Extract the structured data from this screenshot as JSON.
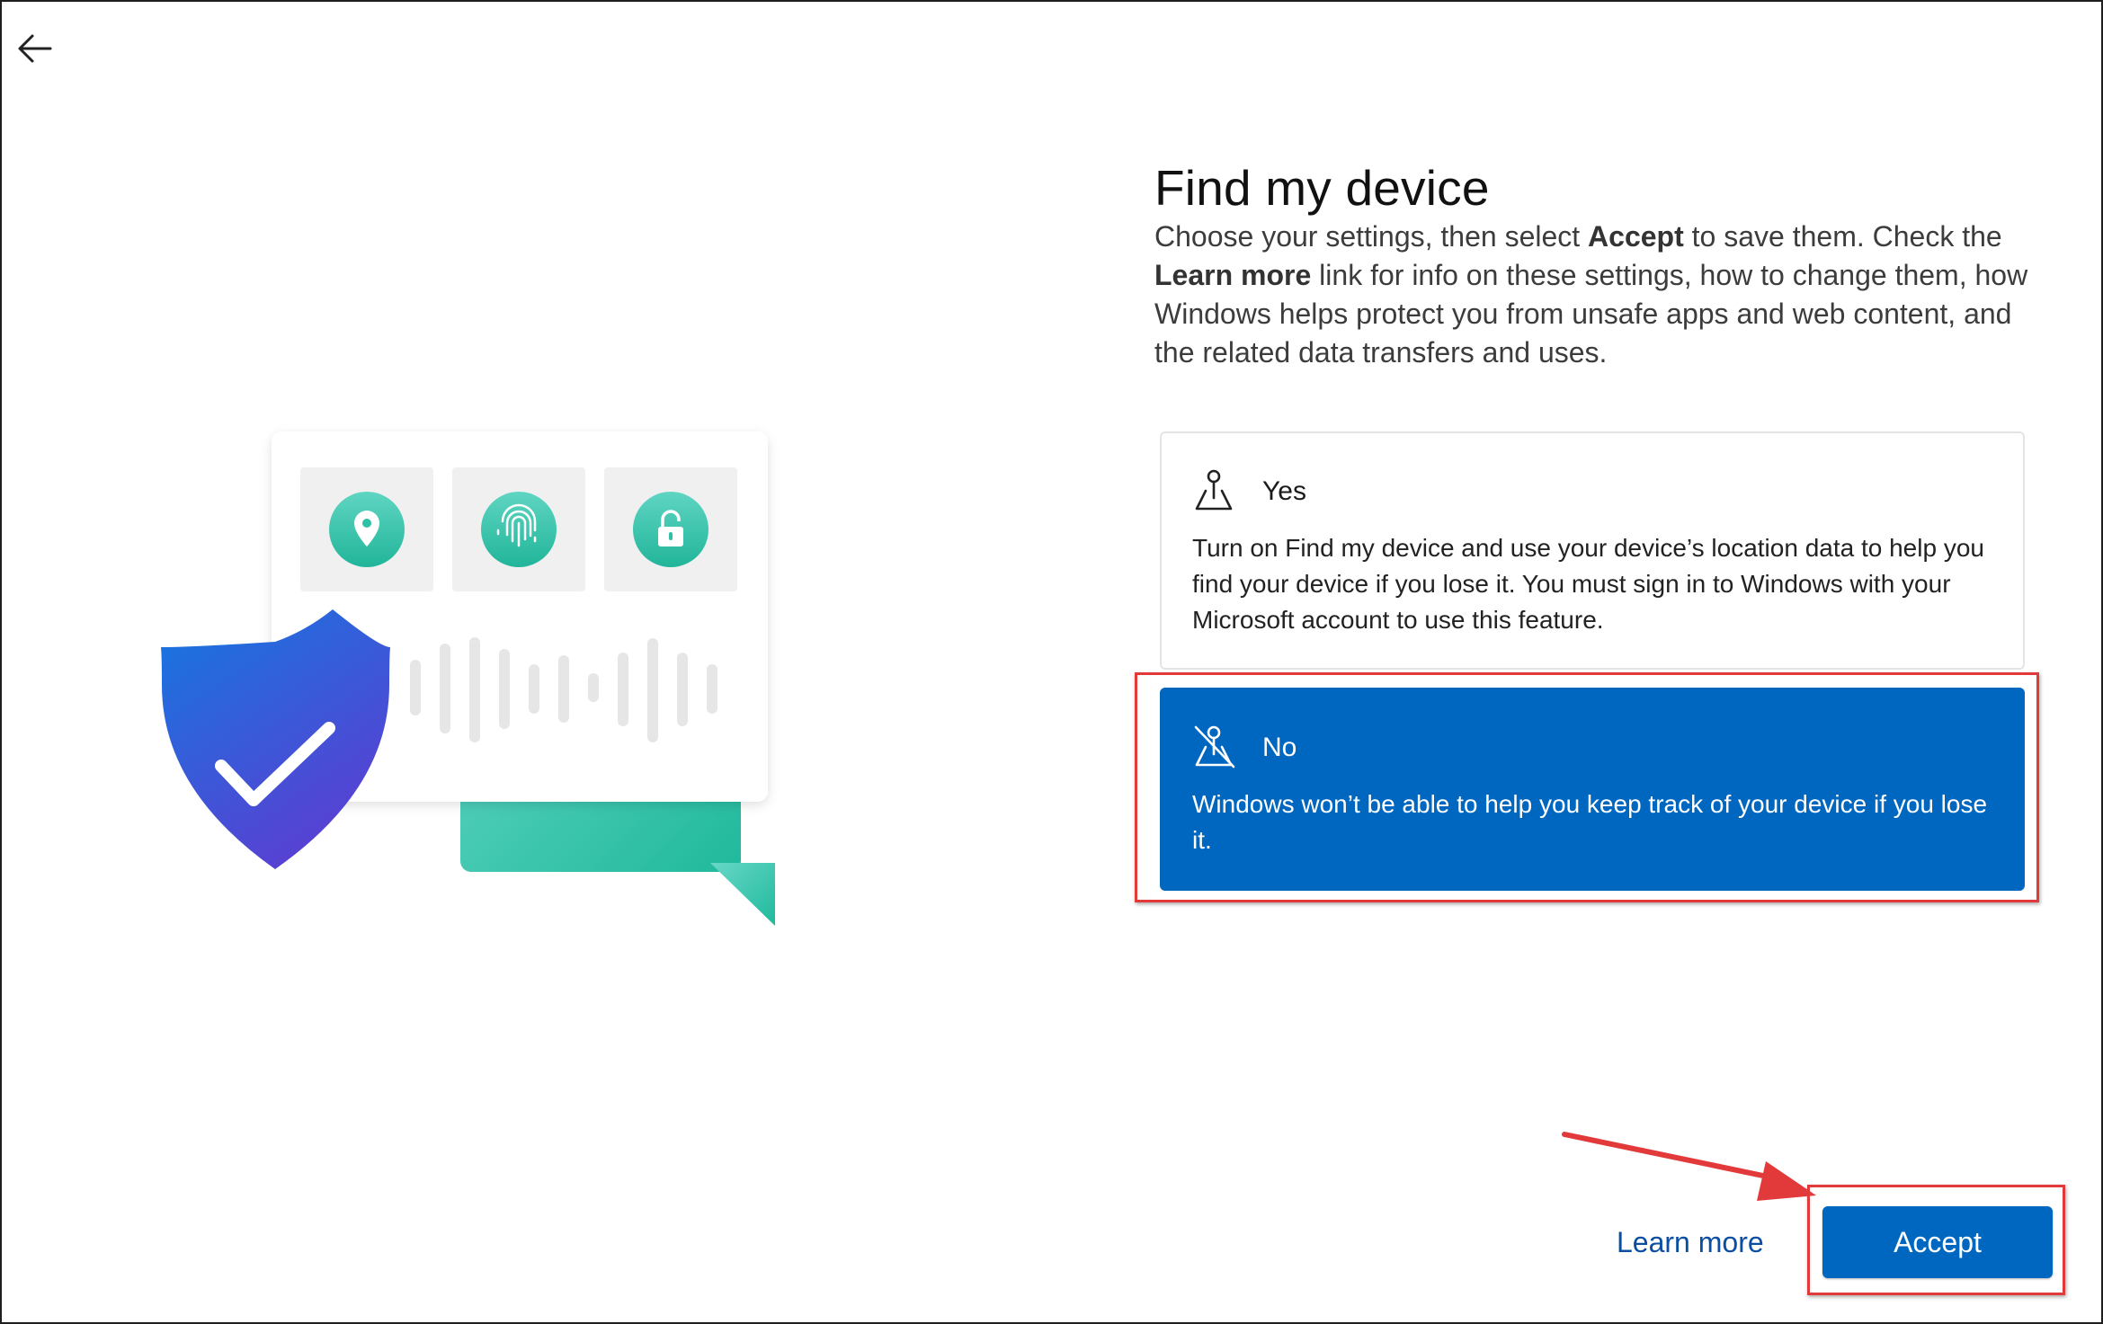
{
  "header": {
    "back_icon": "arrow-left-icon"
  },
  "page": {
    "title": "Find my device",
    "intro_part1": "Choose your settings, then select ",
    "intro_bold1": "Accept",
    "intro_part2": " to save them. Check the ",
    "intro_bold2": "Learn more",
    "intro_part3": " link for info on these settings, how to change them, how Windows helps protect you from unsafe apps and web content, and the related data transfers and uses."
  },
  "options": [
    {
      "label": "Yes",
      "description": "Turn on Find my device and use your device’s location data to help you find your device if you lose it. You must sign in to Windows with your Microsoft account to use this feature.",
      "icon": "location-pin-icon",
      "selected": false
    },
    {
      "label": "No",
      "description": "Windows won’t be able to help you keep track of your device if you lose it.",
      "icon": "location-off-icon",
      "selected": true
    }
  ],
  "footer": {
    "learn_more": "Learn more",
    "accept": "Accept"
  },
  "colors": {
    "accent": "#0067c0",
    "highlight": "#e23a3a",
    "link": "#0a4ea3",
    "teal": "#2fc1a5"
  }
}
